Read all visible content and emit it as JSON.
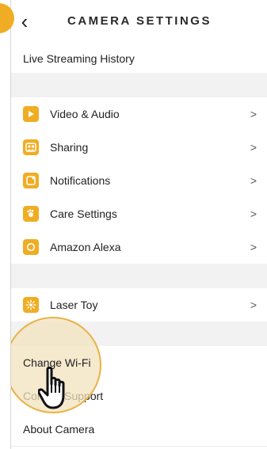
{
  "header": {
    "title": "CAMERA SETTINGS",
    "back_icon": "chevron-left-icon"
  },
  "top_item": {
    "label": "Live Streaming History"
  },
  "group1": [
    {
      "label": "Video & Audio",
      "icon": "play-icon"
    },
    {
      "label": "Sharing",
      "icon": "people-icon"
    },
    {
      "label": "Notifications",
      "icon": "notification-icon"
    },
    {
      "label": "Care Settings",
      "icon": "care-icon"
    },
    {
      "label": "Amazon Alexa",
      "icon": "alexa-icon"
    }
  ],
  "group2": [
    {
      "label": "Laser Toy",
      "icon": "laser-icon"
    }
  ],
  "group3": [
    {
      "label": "Change Wi-Fi"
    },
    {
      "label": "Contact Support"
    },
    {
      "label": "About Camera"
    }
  ],
  "colors": {
    "accent": "#f0ad23",
    "highlight_ring": "#e8b345"
  },
  "cursor_icon": "hand-pointer-icon"
}
